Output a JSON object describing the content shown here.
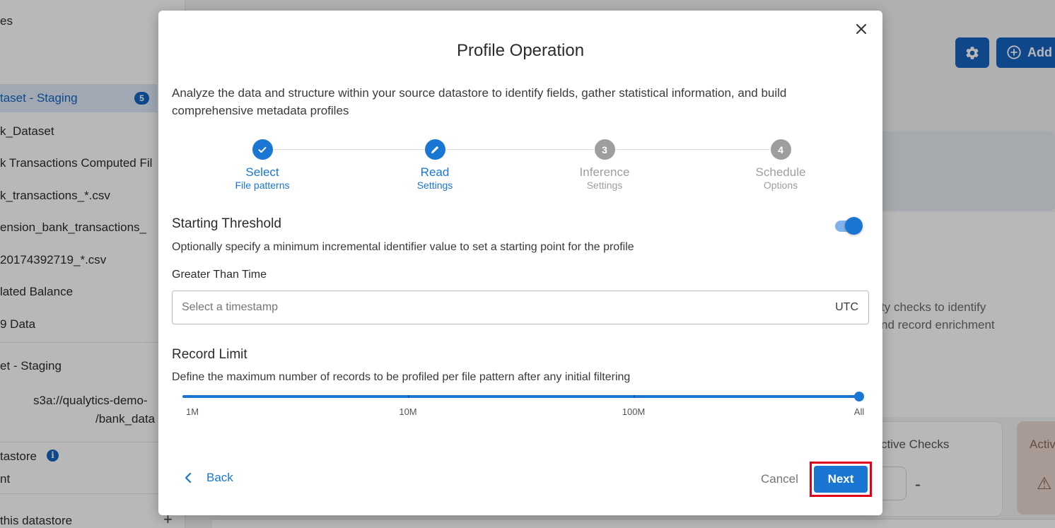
{
  "background": {
    "sidebar_items": [
      {
        "label": "es"
      },
      {
        "label": "taset - Staging"
      },
      {
        "label": "k_Dataset"
      },
      {
        "label": "k Transactions Computed Fil"
      },
      {
        "label": "k_transactions_*.csv"
      },
      {
        "label": "ension_bank_transactions_"
      },
      {
        "label": "20174392719_*.csv"
      },
      {
        "label": "lated Balance"
      },
      {
        "label": "9 Data"
      },
      {
        "label": "et - Staging"
      },
      {
        "label": "s3a://qualytics-demo-"
      },
      {
        "label": "/bank_data"
      },
      {
        "label": "tastore"
      },
      {
        "label": "nt"
      },
      {
        "label": "this datastore"
      }
    ],
    "badge_count": "5",
    "add_button_label": "Add",
    "info_glyph": "i",
    "plus_glyph": "+",
    "main_text_1": "ty checks to identify",
    "main_text_2": "nd record enrichment",
    "active_checks_label": "ctive Checks",
    "active_label_2": "Activ",
    "dash": "-"
  },
  "modal": {
    "title": "Profile Operation",
    "description": "Analyze the data and structure within your source datastore to identify fields, gather statistical information, and build comprehensive metadata profiles",
    "steps": [
      {
        "number": "1",
        "title": "Select",
        "subtitle": "File patterns",
        "state": "done",
        "icon": "check-icon"
      },
      {
        "number": "2",
        "title": "Read",
        "subtitle": "Settings",
        "state": "active",
        "icon": "pencil-icon"
      },
      {
        "number": "3",
        "title": "Inference",
        "subtitle": "Settings",
        "state": "todo"
      },
      {
        "number": "4",
        "title": "Schedule",
        "subtitle": "Options",
        "state": "todo"
      }
    ],
    "starting_threshold": {
      "title": "Starting Threshold",
      "description": "Optionally specify a minimum incremental identifier value to set a starting point for the profile",
      "enabled": true,
      "field_label": "Greater Than Time",
      "placeholder": "Select a timestamp",
      "value": "",
      "suffix": "UTC"
    },
    "record_limit": {
      "title": "Record Limit",
      "description": "Define the maximum number of records to be profiled per file pattern after any initial filtering",
      "marks": [
        "1M",
        "10M",
        "100M",
        "All"
      ],
      "selected": "All"
    },
    "back_label": "Back",
    "cancel_label": "Cancel",
    "next_label": "Next",
    "close_label": "×"
  },
  "colors": {
    "accent": "#1976d2",
    "brand": "#1565c0",
    "inactive_step": "#9e9e9e",
    "highlight": "#e0001a"
  }
}
